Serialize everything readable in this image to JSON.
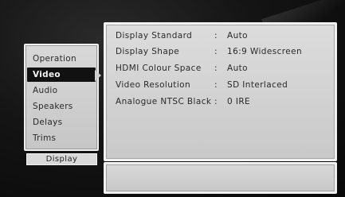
{
  "menu": {
    "items": [
      {
        "label": "Operation",
        "selected": false
      },
      {
        "label": "Video",
        "selected": true
      },
      {
        "label": "Audio",
        "selected": false
      },
      {
        "label": "Speakers",
        "selected": false
      },
      {
        "label": "Delays",
        "selected": false
      },
      {
        "label": "Trims",
        "selected": false
      }
    ],
    "footer_label": "Display"
  },
  "settings": {
    "separator": ":",
    "rows": [
      {
        "label": "Display Standard",
        "value": "Auto"
      },
      {
        "label": "Display Shape",
        "value": "16:9 Widescreen"
      },
      {
        "label": "HDMI Colour Space",
        "value": "Auto"
      },
      {
        "label": "Video Resolution",
        "value": "SD Interlaced"
      },
      {
        "label": "Analogue NTSC Black",
        "value": "0 IRE"
      }
    ]
  }
}
